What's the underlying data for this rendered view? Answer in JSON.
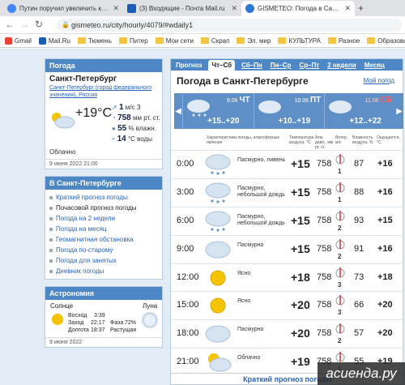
{
  "browser": {
    "tabs": [
      {
        "title": "Путин поручил увеличить кеш",
        "favicon_color": "#4285f4"
      },
      {
        "title": "(3) Входящие - Почта Mail.ru",
        "favicon_color": "#1a5fb4"
      },
      {
        "title": "GISMETEO: Погода в Санкт-Пете",
        "favicon_color": "#2b7ad6"
      }
    ],
    "url": "gismeteo.ru/city/hourly/4079/#wdaily1",
    "bookmarks": [
      "Gmail",
      "Mail.Ru",
      "Тюмень",
      "Питер",
      "Мои сети",
      "Скрап",
      "Эл. мир",
      "КУЛЬТУРА",
      "Разное",
      "Образован"
    ]
  },
  "left": {
    "now_header": "Погода",
    "city": "Санкт-Петербург",
    "region": "Санкт-Петербург (город федерального значения), Россия",
    "temp": "+19°C",
    "wind_val": "1",
    "wind_unit": "м/с",
    "wind_dir": "З",
    "pressure_val": "758",
    "pressure_unit": "мм рт. ст.",
    "humidity_val": "55",
    "humidity_unit": "% влажн.",
    "water_val": "14",
    "water_unit": "°С воды",
    "condition": "Облачно",
    "updated": "9 июня 2022 21:00",
    "links_header": "В Санкт-Петербурге",
    "links": [
      "Краткий прогноз погоды",
      "Почасовой прогноз погоды",
      "Погода на 2 недели",
      "Погода на месяц",
      "Геомагнитная обстановка",
      "Погода по-старому",
      "Погода для занятых",
      "Дневник погоды"
    ],
    "astro_header": "Астрономия",
    "sun_label": "Солнце",
    "moon_label": "Луна",
    "sunrise_label": "Восход",
    "sunrise": "3:39",
    "sunset_label": "Заход",
    "sunset": "22:17",
    "daylen_label": "Долгота",
    "daylen": "18:37",
    "phase_label": "Фаза",
    "phase": "72%",
    "moon_state": "Растущая",
    "astro_date": "9 июня 2022"
  },
  "main": {
    "tabs": [
      "Прогноз",
      "Чт–Сб",
      "Сб–Пн",
      "Пн–Ср",
      "Ср–Пт",
      "2 недели",
      "Месяц"
    ],
    "title": "Погода в Санкт-Петербурге",
    "my_weather": "Мой погод",
    "days": [
      {
        "date": "9.06",
        "dow": "ЧТ",
        "temps": "+15..+20",
        "weekend": false
      },
      {
        "date": "10.06",
        "dow": "ПТ",
        "temps": "+10..+19",
        "weekend": false
      },
      {
        "date": "11.06",
        "dow": "СБ",
        "temps": "+12..+22",
        "weekend": true
      }
    ],
    "col_heads": {
      "cond": "Характеристики погоды, атмосферные явления",
      "temp": "Температура воздуха, °C",
      "press": "Атм. давл., мм рт. ст.",
      "wind": "Ветер, м/с",
      "hum": "Влажность воздуха, %",
      "feel": "Ощущается, °C"
    },
    "rows": [
      {
        "time": "0:00",
        "cond": "Пасмурно, ливень",
        "icon": "cloud-rain",
        "temp": "+15",
        "press": "758",
        "wind": "1",
        "hum": "87",
        "feel": "+16"
      },
      {
        "time": "3:00",
        "cond": "Пасмурно, небольшой дождь",
        "icon": "cloud-rain",
        "temp": "+15",
        "press": "758",
        "wind": "1",
        "hum": "88",
        "feel": "+16"
      },
      {
        "time": "6:00",
        "cond": "Пасмурно, небольшой дождь",
        "icon": "cloud-rain",
        "temp": "+15",
        "press": "758",
        "wind": "2",
        "hum": "93",
        "feel": "+15"
      },
      {
        "time": "9:00",
        "cond": "Пасмурно",
        "icon": "cloud",
        "temp": "+15",
        "press": "758",
        "wind": "2",
        "hum": "91",
        "feel": "+16"
      },
      {
        "time": "12:00",
        "cond": "Ясно",
        "icon": "sun",
        "temp": "+18",
        "press": "758",
        "wind": "3",
        "hum": "73",
        "feel": "+18"
      },
      {
        "time": "15:00",
        "cond": "Ясно",
        "icon": "sun",
        "temp": "+20",
        "press": "758",
        "wind": "3",
        "hum": "66",
        "feel": "+20"
      },
      {
        "time": "18:00",
        "cond": "Пасмурно",
        "icon": "cloud",
        "temp": "+20",
        "press": "758",
        "wind": "2",
        "hum": "57",
        "feel": "+20"
      },
      {
        "time": "21:00",
        "cond": "Облачно",
        "icon": "cloud-sun",
        "temp": "+19",
        "press": "758",
        "wind": "1",
        "hum": "55",
        "feel": "+19"
      }
    ],
    "brief_link": "Краткий прогноз погоды"
  },
  "watermark": "асиенда.ру"
}
